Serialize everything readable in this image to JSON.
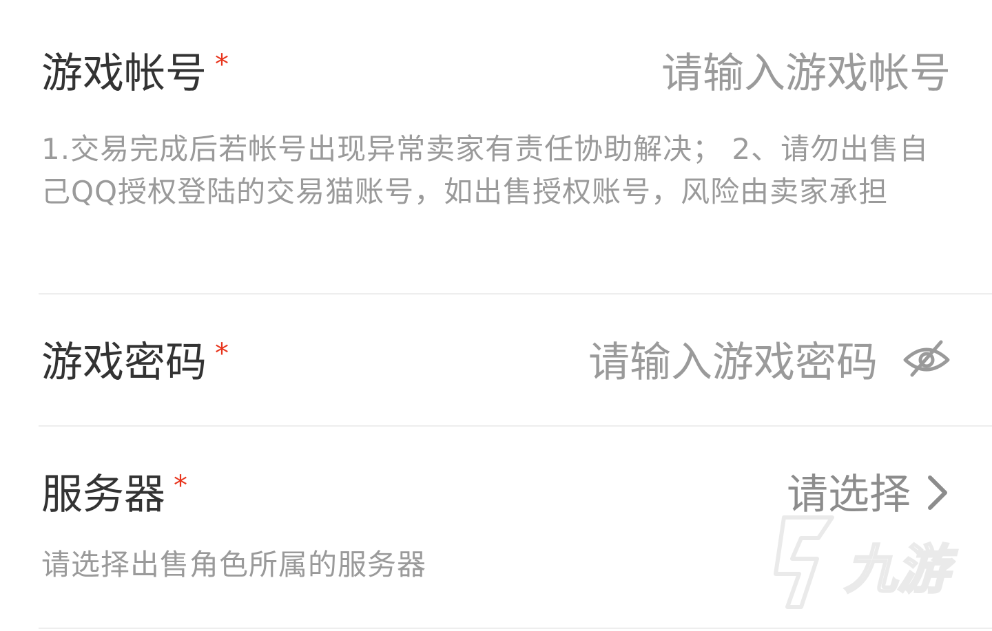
{
  "account": {
    "label": "游戏帐号",
    "required_mark": "*",
    "placeholder": "请输入游戏帐号",
    "value": "",
    "hint": "1.交易完成后若帐号出现异常卖家有责任协助解决； 2、请勿出售自己QQ授权登陆的交易猫账号，如出售授权账号，风险由卖家承担"
  },
  "password": {
    "label": "游戏密码",
    "required_mark": "*",
    "placeholder": "请输入游戏密码",
    "value": "",
    "toggle_icon": "eye-off-icon"
  },
  "server": {
    "label": "服务器",
    "required_mark": "*",
    "select_placeholder": "请选择",
    "chevron_icon": "chevron-right-icon",
    "hint": "请选择出售角色所属的服务器"
  },
  "watermark": {
    "text": "九游",
    "icon": "jiuyou-logo"
  },
  "colors": {
    "required": "#e8341c",
    "label": "#333333",
    "placeholder": "#9a9a9a",
    "hint": "#9a9a9a",
    "divider": "#eeeeee"
  }
}
